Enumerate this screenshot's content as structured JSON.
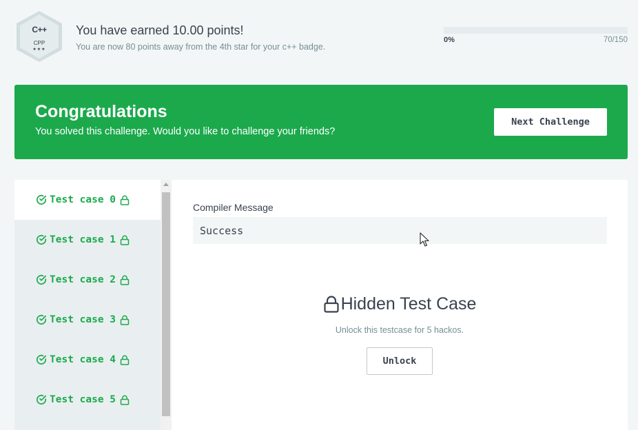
{
  "badge": {
    "logo": "C++",
    "name": "CPP",
    "stars": "★★★"
  },
  "points": {
    "title": "You have earned 10.00 points!",
    "subtitle": "You are now 80 points away from the 4th star for your c++ badge.",
    "progress_label": "0%",
    "progress_count": "70/150",
    "progress_fraction": 0.0
  },
  "banner": {
    "title": "Congratulations",
    "subtitle": "You solved this challenge. Would you like to challenge your friends?",
    "next_button": "Next Challenge"
  },
  "test_cases": [
    {
      "label": "Test case 0",
      "active": true
    },
    {
      "label": "Test case 1",
      "active": false
    },
    {
      "label": "Test case 2",
      "active": false
    },
    {
      "label": "Test case 3",
      "active": false
    },
    {
      "label": "Test case 4",
      "active": false
    },
    {
      "label": "Test case 5",
      "active": false
    }
  ],
  "compiler": {
    "label": "Compiler Message",
    "message": "Success"
  },
  "hidden": {
    "title": "Hidden Test Case",
    "note": "Unlock this testcase for 5 hackos.",
    "button": "Unlock"
  },
  "colors": {
    "accent_green": "#1ba94c",
    "text_dark": "#39424e",
    "text_muted": "#738f93"
  }
}
